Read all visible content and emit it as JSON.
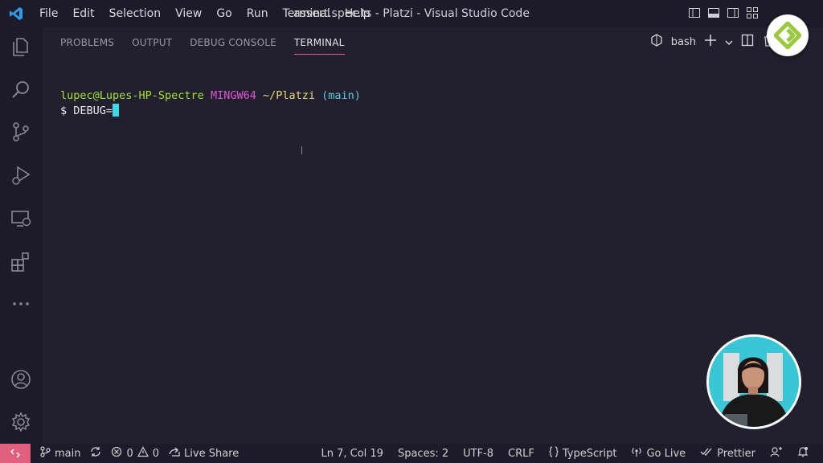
{
  "window": {
    "title": "assert.spec.ts - Platzi - Visual Studio Code"
  },
  "menu": [
    "File",
    "Edit",
    "Selection",
    "View",
    "Go",
    "Run",
    "Terminal",
    "Help"
  ],
  "panel": {
    "tabs": [
      "PROBLEMS",
      "OUTPUT",
      "DEBUG CONSOLE",
      "TERMINAL"
    ],
    "active_tab": "TERMINAL",
    "shell": "bash"
  },
  "terminal": {
    "user_host": "lupec@Lupes-HP-Spectre",
    "system": "MINGW64",
    "path": "~/Platzi",
    "branch": "(main)",
    "prompt": "$",
    "command": "DEBUG="
  },
  "statusbar": {
    "branch": "main",
    "errors": "0",
    "warnings": "0",
    "live_share": "Live Share",
    "position": "Ln 7, Col 19",
    "spaces": "Spaces: 2",
    "encoding": "UTF-8",
    "eol": "CRLF",
    "language": "TypeScript",
    "go_live": "Go Live",
    "prettier": "Prettier"
  },
  "colors": {
    "accent": "#e0607e",
    "brand_badge": "#98ca3f",
    "cursor": "#3fd6e6",
    "background": "#22202f"
  }
}
